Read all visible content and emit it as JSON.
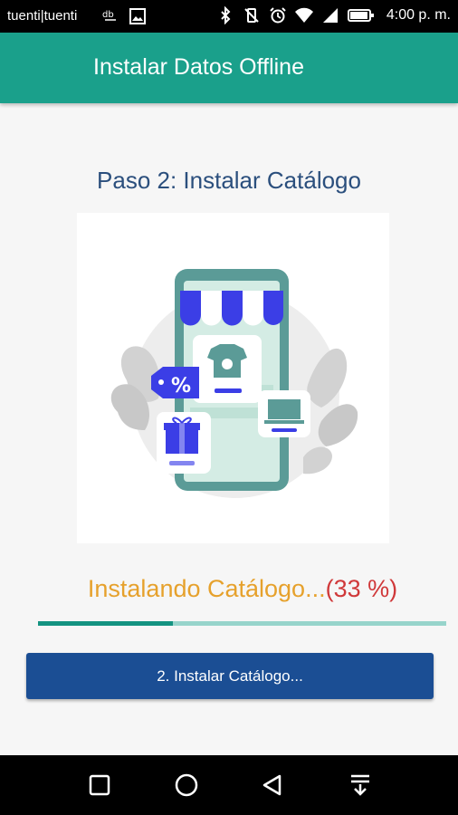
{
  "status_bar": {
    "carrier": "tuenti|tuenti",
    "time": "4:00 p. m.",
    "icons": [
      "data-icon",
      "image-icon",
      "bluetooth-icon",
      "vibrate-off-icon",
      "alarm-icon",
      "wifi-icon",
      "signal-icon",
      "battery-icon"
    ]
  },
  "app_bar": {
    "title": "Instalar Datos Offline"
  },
  "main": {
    "step_title": "Paso 2: Instalar Catálogo",
    "progress": {
      "label": "Instalando Catálogo...",
      "percent_text": "(33 %)",
      "value": 0.33
    },
    "install_button_label": "2. Instalar Catálogo..."
  },
  "colors": {
    "app_bar": "#1aa08b",
    "step_title": "#2b4f7d",
    "progress_label": "#e6a12c",
    "progress_percent": "#d0393a",
    "progress_fill": "#149381",
    "progress_track": "#97d4cb",
    "button": "#1b4e94"
  },
  "nav_bar": {
    "icons": [
      "recents-square-icon",
      "home-circle-icon",
      "back-triangle-icon",
      "notification-pull-icon"
    ]
  }
}
